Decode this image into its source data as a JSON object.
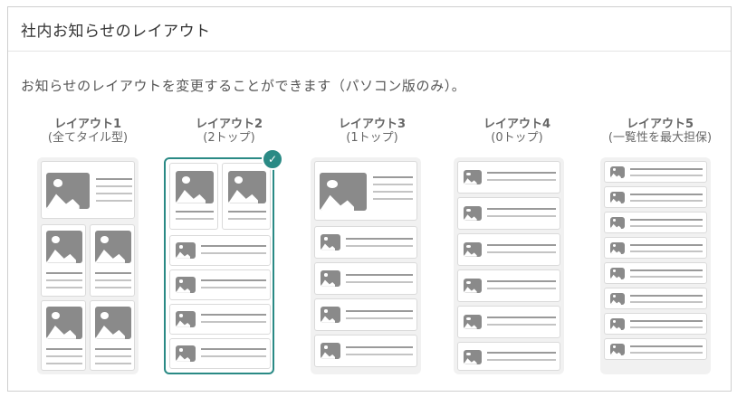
{
  "panel": {
    "title": "社内お知らせのレイアウト",
    "description": "お知らせのレイアウトを変更することができます（パソコン版のみ）。"
  },
  "layouts": [
    {
      "label": "レイアウト1",
      "sub": "(全てタイル型)"
    },
    {
      "label": "レイアウト2",
      "sub": "(2トップ)",
      "selected": true
    },
    {
      "label": "レイアウト3",
      "sub": "(1トップ)"
    },
    {
      "label": "レイアウト4",
      "sub": "(0トップ)"
    },
    {
      "label": "レイアウト5",
      "sub": "(一覧性を最大担保)"
    }
  ],
  "colors": {
    "accent": "#2a8a85",
    "placeholder": "#8a8a8a"
  },
  "icons": {
    "selected": "check-icon",
    "thumbnail": "image-icon"
  }
}
